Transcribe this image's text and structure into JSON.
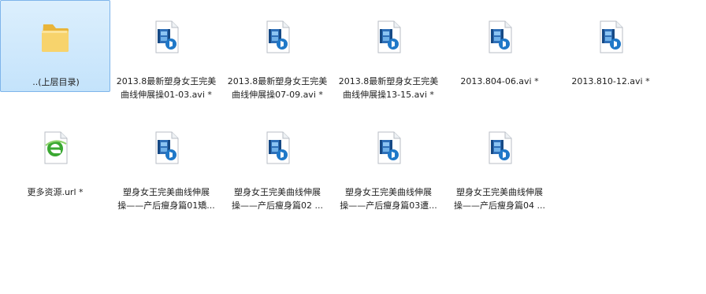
{
  "files": [
    {
      "name": "..(上层目录)",
      "icon": "folder-icon",
      "selected": true
    },
    {
      "name_lines": [
        "2013.8最新塑身女王完美",
        "曲线伸展操01-03.avi *"
      ],
      "icon": "video-file-icon"
    },
    {
      "name_lines": [
        "2013.8最新塑身女王完美",
        "曲线伸展操07-09.avi *"
      ],
      "icon": "video-file-icon"
    },
    {
      "name_lines": [
        "2013.8最新塑身女王完美",
        "曲线伸展操13-15.avi *"
      ],
      "icon": "video-file-icon"
    },
    {
      "name": "2013.804-06.avi *",
      "icon": "video-file-icon"
    },
    {
      "name": "2013.810-12.avi *",
      "icon": "video-file-icon"
    },
    {
      "name": "更多资源.url *",
      "icon": "internet-shortcut-icon"
    },
    {
      "name_lines": [
        "塑身女王完美曲线伸展",
        "操——产后瘦身篇01矯..."
      ],
      "icon": "video-file-icon"
    },
    {
      "name_lines": [
        "塑身女王完美曲线伸展",
        "操——产后瘦身篇02 ..."
      ],
      "icon": "video-file-icon"
    },
    {
      "name_lines": [
        "塑身女王完美曲线伸展",
        "操——产后瘦身篇03遭..."
      ],
      "icon": "video-file-icon"
    },
    {
      "name_lines": [
        "塑身女王完美曲线伸展",
        "操——产后瘦身篇04 ..."
      ],
      "icon": "video-file-icon"
    }
  ],
  "colors": {
    "selection_bg": "#cce8ff",
    "selection_border": "#7eb4ea",
    "folder": "#f0c24a",
    "video_blue": "#1f78c8",
    "ie_green": "#3aa832"
  }
}
